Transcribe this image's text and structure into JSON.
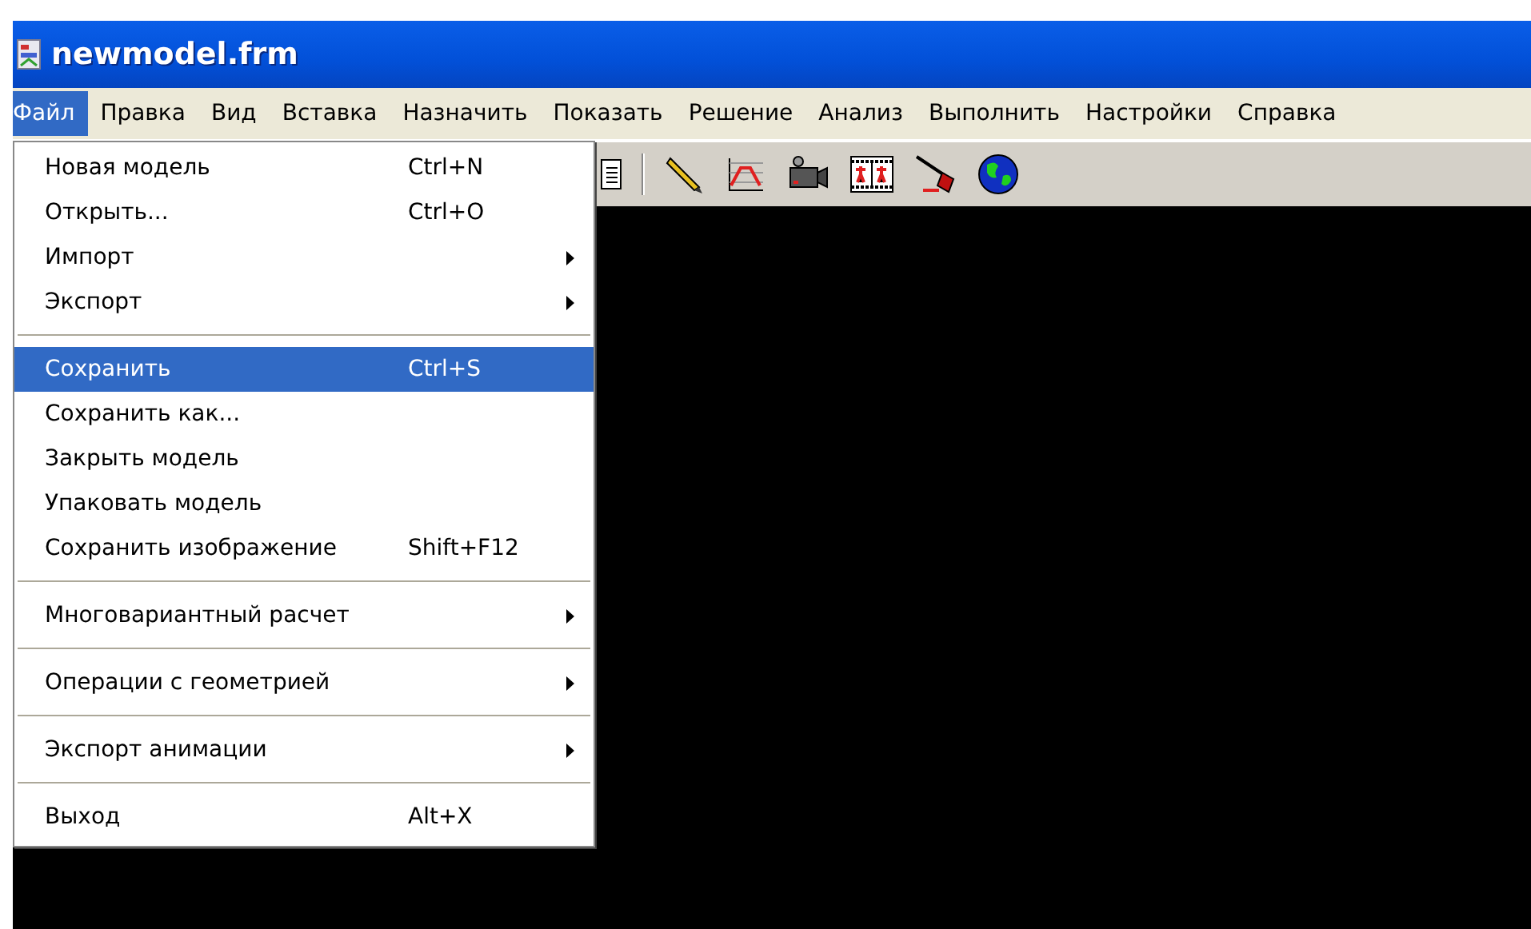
{
  "window": {
    "title": "newmodel.frm"
  },
  "menu_bar": [
    {
      "label": "Файл",
      "selected": true
    },
    {
      "label": "Правка",
      "selected": false
    },
    {
      "label": "Вид",
      "selected": false
    },
    {
      "label": "Вставка",
      "selected": false
    },
    {
      "label": "Назначить",
      "selected": false
    },
    {
      "label": "Показать",
      "selected": false
    },
    {
      "label": "Решение",
      "selected": false
    },
    {
      "label": "Анализ",
      "selected": false
    },
    {
      "label": "Выполнить",
      "selected": false
    },
    {
      "label": "Настройки",
      "selected": false
    },
    {
      "label": "Справка",
      "selected": false
    }
  ],
  "file_menu": [
    {
      "kind": "item",
      "label": "Новая модель",
      "shortcut": "Ctrl+N",
      "submenu": false,
      "selected": false
    },
    {
      "kind": "item",
      "label": "Открыть...",
      "shortcut": "Ctrl+O",
      "submenu": false,
      "selected": false
    },
    {
      "kind": "item",
      "label": "Импорт",
      "submenu": true,
      "selected": false
    },
    {
      "kind": "item",
      "label": "Экспорт",
      "submenu": true,
      "selected": false
    },
    {
      "kind": "separator"
    },
    {
      "kind": "item",
      "label": "Сохранить",
      "shortcut": "Ctrl+S",
      "submenu": false,
      "selected": true
    },
    {
      "kind": "item",
      "label": "Сохранить как...",
      "submenu": false,
      "selected": false
    },
    {
      "kind": "item",
      "label": "Закрыть модель",
      "submenu": false,
      "selected": false
    },
    {
      "kind": "item",
      "label": "Упаковать модель",
      "submenu": false,
      "selected": false
    },
    {
      "kind": "item",
      "label": "Сохранить изображение",
      "shortcut": "Shift+F12",
      "submenu": false,
      "selected": false
    },
    {
      "kind": "separator"
    },
    {
      "kind": "item",
      "label": "Многовариантный расчет",
      "submenu": true,
      "selected": false
    },
    {
      "kind": "separator"
    },
    {
      "kind": "item",
      "label": "Операции с геометрией",
      "submenu": true,
      "selected": false
    },
    {
      "kind": "separator"
    },
    {
      "kind": "item",
      "label": "Экспорт анимации",
      "submenu": true,
      "selected": false
    },
    {
      "kind": "separator"
    },
    {
      "kind": "item",
      "label": "Выход",
      "shortcut": "Alt+X",
      "submenu": false,
      "selected": false
    }
  ]
}
